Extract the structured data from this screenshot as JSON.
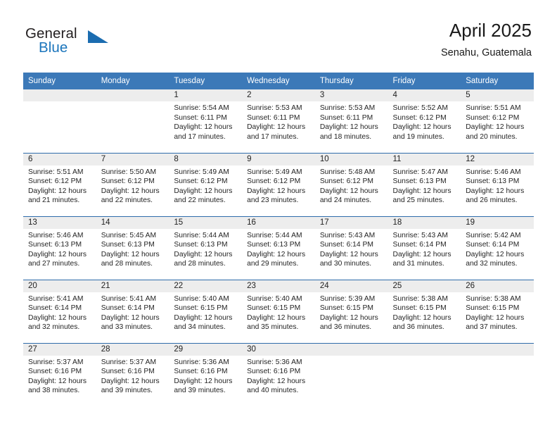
{
  "brand": {
    "name_top": "General",
    "name_bottom": "Blue",
    "accent_color": "#1b75bc",
    "triangle_color": "#1b6cb0"
  },
  "header": {
    "title": "April 2025",
    "subtitle": "Senahu, Guatemala"
  },
  "calendar": {
    "header_color": "#3c79b8",
    "daynum_band_color": "#ededed",
    "row_separator_color": "#2f6cab",
    "weekday_headers": [
      "Sunday",
      "Monday",
      "Tuesday",
      "Wednesday",
      "Thursday",
      "Friday",
      "Saturday"
    ],
    "weeks": [
      [
        {
          "day": "",
          "lines": []
        },
        {
          "day": "",
          "lines": []
        },
        {
          "day": "1",
          "lines": [
            "Sunrise: 5:54 AM",
            "Sunset: 6:11 PM",
            "Daylight: 12 hours",
            "and 17 minutes."
          ]
        },
        {
          "day": "2",
          "lines": [
            "Sunrise: 5:53 AM",
            "Sunset: 6:11 PM",
            "Daylight: 12 hours",
            "and 17 minutes."
          ]
        },
        {
          "day": "3",
          "lines": [
            "Sunrise: 5:53 AM",
            "Sunset: 6:11 PM",
            "Daylight: 12 hours",
            "and 18 minutes."
          ]
        },
        {
          "day": "4",
          "lines": [
            "Sunrise: 5:52 AM",
            "Sunset: 6:12 PM",
            "Daylight: 12 hours",
            "and 19 minutes."
          ]
        },
        {
          "day": "5",
          "lines": [
            "Sunrise: 5:51 AM",
            "Sunset: 6:12 PM",
            "Daylight: 12 hours",
            "and 20 minutes."
          ]
        }
      ],
      [
        {
          "day": "6",
          "lines": [
            "Sunrise: 5:51 AM",
            "Sunset: 6:12 PM",
            "Daylight: 12 hours",
            "and 21 minutes."
          ]
        },
        {
          "day": "7",
          "lines": [
            "Sunrise: 5:50 AM",
            "Sunset: 6:12 PM",
            "Daylight: 12 hours",
            "and 22 minutes."
          ]
        },
        {
          "day": "8",
          "lines": [
            "Sunrise: 5:49 AM",
            "Sunset: 6:12 PM",
            "Daylight: 12 hours",
            "and 22 minutes."
          ]
        },
        {
          "day": "9",
          "lines": [
            "Sunrise: 5:49 AM",
            "Sunset: 6:12 PM",
            "Daylight: 12 hours",
            "and 23 minutes."
          ]
        },
        {
          "day": "10",
          "lines": [
            "Sunrise: 5:48 AM",
            "Sunset: 6:12 PM",
            "Daylight: 12 hours",
            "and 24 minutes."
          ]
        },
        {
          "day": "11",
          "lines": [
            "Sunrise: 5:47 AM",
            "Sunset: 6:13 PM",
            "Daylight: 12 hours",
            "and 25 minutes."
          ]
        },
        {
          "day": "12",
          "lines": [
            "Sunrise: 5:46 AM",
            "Sunset: 6:13 PM",
            "Daylight: 12 hours",
            "and 26 minutes."
          ]
        }
      ],
      [
        {
          "day": "13",
          "lines": [
            "Sunrise: 5:46 AM",
            "Sunset: 6:13 PM",
            "Daylight: 12 hours",
            "and 27 minutes."
          ]
        },
        {
          "day": "14",
          "lines": [
            "Sunrise: 5:45 AM",
            "Sunset: 6:13 PM",
            "Daylight: 12 hours",
            "and 28 minutes."
          ]
        },
        {
          "day": "15",
          "lines": [
            "Sunrise: 5:44 AM",
            "Sunset: 6:13 PM",
            "Daylight: 12 hours",
            "and 28 minutes."
          ]
        },
        {
          "day": "16",
          "lines": [
            "Sunrise: 5:44 AM",
            "Sunset: 6:13 PM",
            "Daylight: 12 hours",
            "and 29 minutes."
          ]
        },
        {
          "day": "17",
          "lines": [
            "Sunrise: 5:43 AM",
            "Sunset: 6:14 PM",
            "Daylight: 12 hours",
            "and 30 minutes."
          ]
        },
        {
          "day": "18",
          "lines": [
            "Sunrise: 5:43 AM",
            "Sunset: 6:14 PM",
            "Daylight: 12 hours",
            "and 31 minutes."
          ]
        },
        {
          "day": "19",
          "lines": [
            "Sunrise: 5:42 AM",
            "Sunset: 6:14 PM",
            "Daylight: 12 hours",
            "and 32 minutes."
          ]
        }
      ],
      [
        {
          "day": "20",
          "lines": [
            "Sunrise: 5:41 AM",
            "Sunset: 6:14 PM",
            "Daylight: 12 hours",
            "and 32 minutes."
          ]
        },
        {
          "day": "21",
          "lines": [
            "Sunrise: 5:41 AM",
            "Sunset: 6:14 PM",
            "Daylight: 12 hours",
            "and 33 minutes."
          ]
        },
        {
          "day": "22",
          "lines": [
            "Sunrise: 5:40 AM",
            "Sunset: 6:15 PM",
            "Daylight: 12 hours",
            "and 34 minutes."
          ]
        },
        {
          "day": "23",
          "lines": [
            "Sunrise: 5:40 AM",
            "Sunset: 6:15 PM",
            "Daylight: 12 hours",
            "and 35 minutes."
          ]
        },
        {
          "day": "24",
          "lines": [
            "Sunrise: 5:39 AM",
            "Sunset: 6:15 PM",
            "Daylight: 12 hours",
            "and 36 minutes."
          ]
        },
        {
          "day": "25",
          "lines": [
            "Sunrise: 5:38 AM",
            "Sunset: 6:15 PM",
            "Daylight: 12 hours",
            "and 36 minutes."
          ]
        },
        {
          "day": "26",
          "lines": [
            "Sunrise: 5:38 AM",
            "Sunset: 6:15 PM",
            "Daylight: 12 hours",
            "and 37 minutes."
          ]
        }
      ],
      [
        {
          "day": "27",
          "lines": [
            "Sunrise: 5:37 AM",
            "Sunset: 6:16 PM",
            "Daylight: 12 hours",
            "and 38 minutes."
          ]
        },
        {
          "day": "28",
          "lines": [
            "Sunrise: 5:37 AM",
            "Sunset: 6:16 PM",
            "Daylight: 12 hours",
            "and 39 minutes."
          ]
        },
        {
          "day": "29",
          "lines": [
            "Sunrise: 5:36 AM",
            "Sunset: 6:16 PM",
            "Daylight: 12 hours",
            "and 39 minutes."
          ]
        },
        {
          "day": "30",
          "lines": [
            "Sunrise: 5:36 AM",
            "Sunset: 6:16 PM",
            "Daylight: 12 hours",
            "and 40 minutes."
          ]
        },
        {
          "day": "",
          "lines": []
        },
        {
          "day": "",
          "lines": []
        },
        {
          "day": "",
          "lines": []
        }
      ]
    ]
  }
}
